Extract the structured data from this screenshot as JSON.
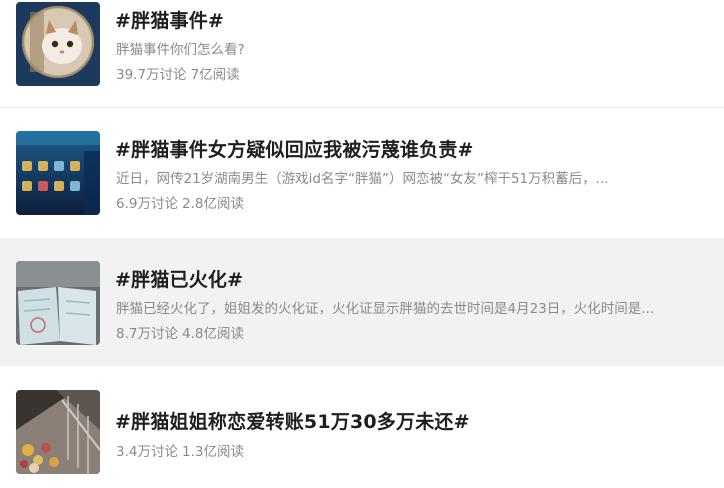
{
  "topics": [
    {
      "title": "#胖猫事件#",
      "desc": "胖猫事件你们怎么看?",
      "discussions": "39.7万讨论",
      "reads": "7亿阅读",
      "thumb_icon": "cat-avatar-image"
    },
    {
      "title": "#胖猫事件女方疑似回应我被污蔑谁负责#",
      "desc": "近日，网传21岁湖南男生（游戏id名字“胖猫”）网恋被“女友”榨干51万积蓄后，...",
      "discussions": "6.9万讨论",
      "reads": "2.8亿阅读",
      "thumb_icon": "game-screenshot-image"
    },
    {
      "title": "#胖猫已火化#",
      "desc": "胖猫已经火化了，姐姐发的火化证，火化证显示胖猫的去世时间是4月23日，火化时间是...",
      "discussions": "8.7万讨论",
      "reads": "4.8亿阅读",
      "thumb_icon": "cremation-certificate-image"
    },
    {
      "title": "#胖猫姐姐称恋爱转账51万30多万未还#",
      "desc": "",
      "discussions": "3.4万讨论",
      "reads": "1.3亿阅读",
      "thumb_icon": "street-flowers-image"
    }
  ],
  "colors": {
    "highlight_background": "#f2f2f2",
    "title": "#1f1f1f",
    "meta": "#8a8a8a"
  }
}
